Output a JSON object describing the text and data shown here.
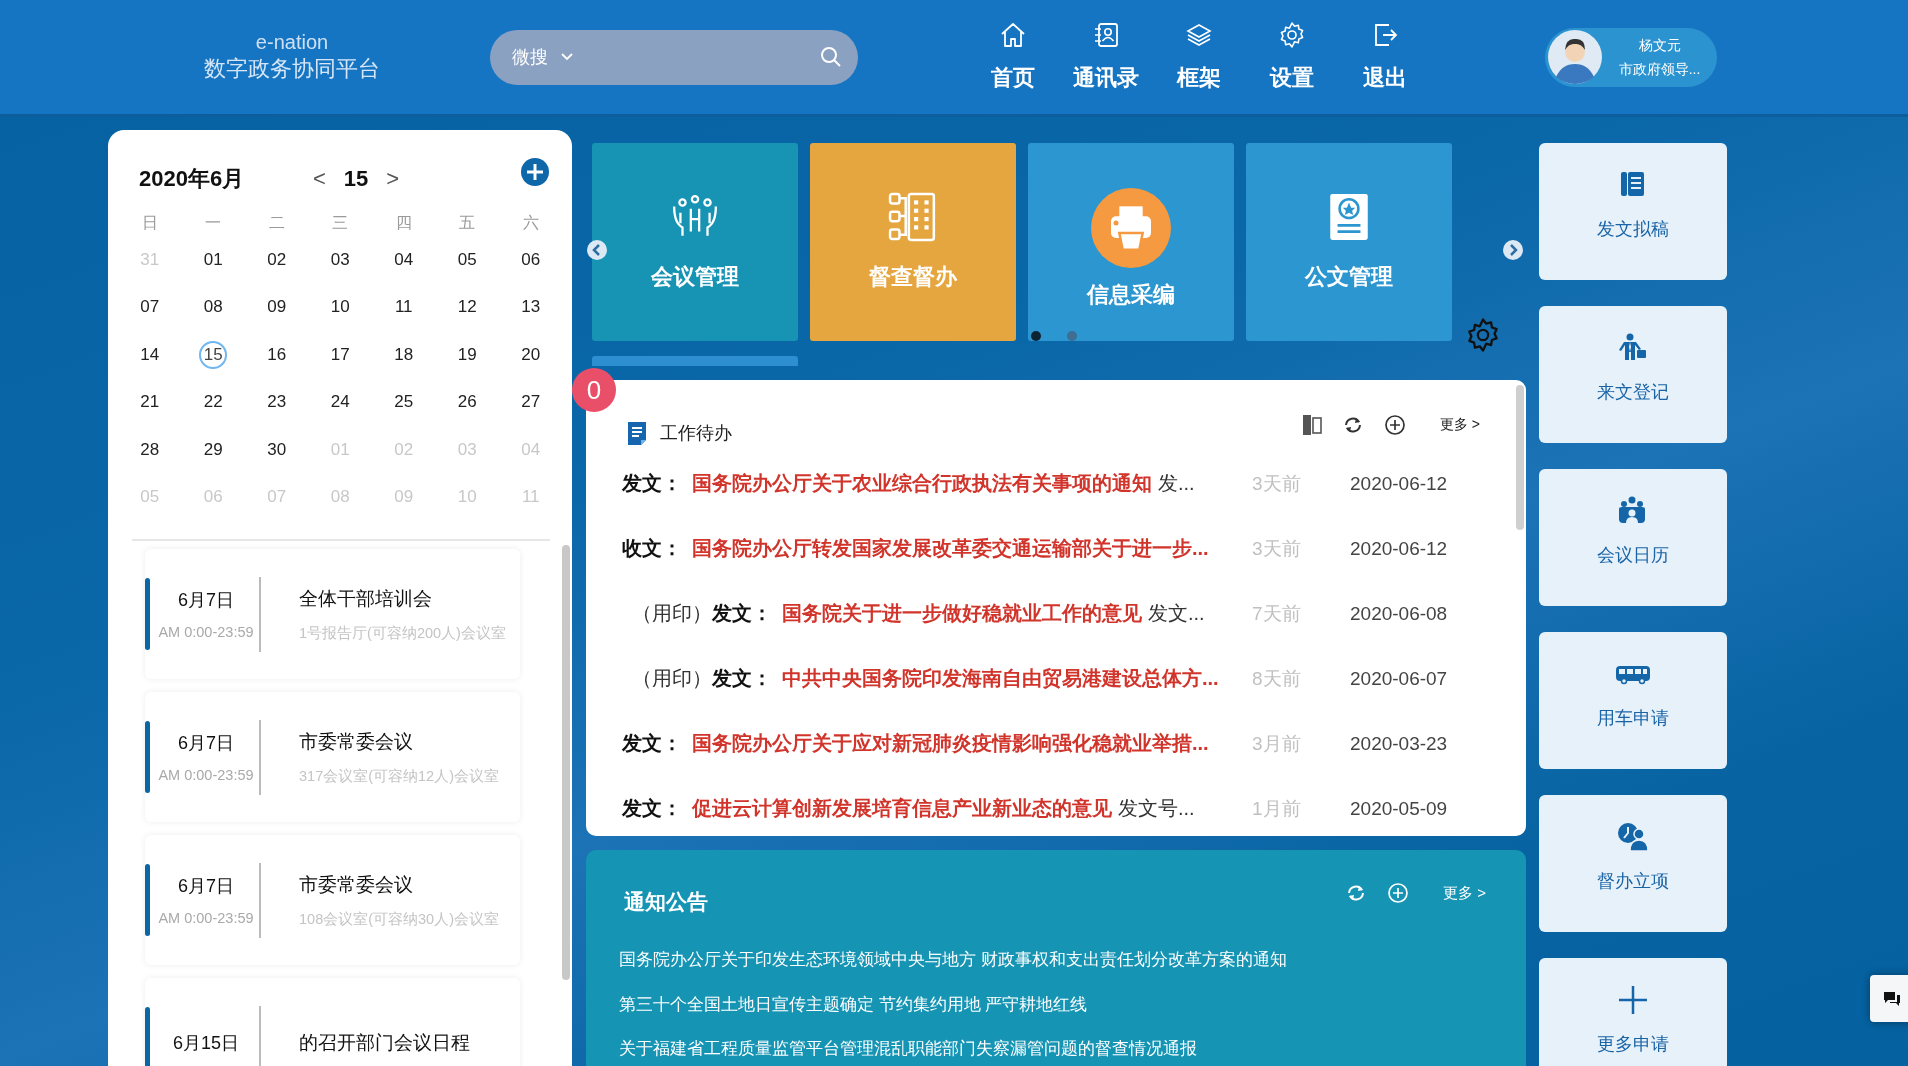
{
  "header": {
    "logo_top": "e-nation",
    "logo_bottom": "数字政务协同平台",
    "search": {
      "scope": "微搜"
    },
    "nav": [
      {
        "label": "首页",
        "kind": "home"
      },
      {
        "label": "通讯录",
        "kind": "contacts"
      },
      {
        "label": "框架",
        "kind": "layers"
      },
      {
        "label": "设置",
        "kind": "settings"
      },
      {
        "label": "退出",
        "kind": "exit"
      }
    ],
    "user": {
      "name": "杨文元",
      "role": "市政府领导..."
    }
  },
  "calendar": {
    "title": "2020年6月",
    "prev": "<",
    "day": "15",
    "next": ">",
    "weekdays": [
      "日",
      "一",
      "二",
      "三",
      "四",
      "五",
      "六"
    ],
    "weeks": [
      [
        {
          "day": "31",
          "muted": true,
          "selected": false
        },
        {
          "day": "01",
          "muted": false,
          "selected": false
        },
        {
          "day": "02",
          "muted": false,
          "selected": false
        },
        {
          "day": "03",
          "muted": false,
          "selected": false
        },
        {
          "day": "04",
          "muted": false,
          "selected": false
        },
        {
          "day": "05",
          "muted": false,
          "selected": false
        },
        {
          "day": "06",
          "muted": false,
          "selected": false
        }
      ],
      [
        {
          "day": "07",
          "muted": false,
          "selected": false
        },
        {
          "day": "08",
          "muted": false,
          "selected": false
        },
        {
          "day": "09",
          "muted": false,
          "selected": false
        },
        {
          "day": "10",
          "muted": false,
          "selected": false
        },
        {
          "day": "11",
          "muted": false,
          "selected": false
        },
        {
          "day": "12",
          "muted": false,
          "selected": false
        },
        {
          "day": "13",
          "muted": false,
          "selected": false
        }
      ],
      [
        {
          "day": "14",
          "muted": false,
          "selected": false
        },
        {
          "day": "15",
          "muted": false,
          "selected": true
        },
        {
          "day": "16",
          "muted": false,
          "selected": false
        },
        {
          "day": "17",
          "muted": false,
          "selected": false
        },
        {
          "day": "18",
          "muted": false,
          "selected": false
        },
        {
          "day": "19",
          "muted": false,
          "selected": false
        },
        {
          "day": "20",
          "muted": false,
          "selected": false
        }
      ],
      [
        {
          "day": "21",
          "muted": false,
          "selected": false
        },
        {
          "day": "22",
          "muted": false,
          "selected": false
        },
        {
          "day": "23",
          "muted": false,
          "selected": false
        },
        {
          "day": "24",
          "muted": false,
          "selected": false
        },
        {
          "day": "25",
          "muted": false,
          "selected": false
        },
        {
          "day": "26",
          "muted": false,
          "selected": false
        },
        {
          "day": "27",
          "muted": false,
          "selected": false
        }
      ],
      [
        {
          "day": "28",
          "muted": false,
          "selected": false
        },
        {
          "day": "29",
          "muted": false,
          "selected": false
        },
        {
          "day": "30",
          "muted": false,
          "selected": false
        },
        {
          "day": "01",
          "muted": true,
          "selected": false
        },
        {
          "day": "02",
          "muted": true,
          "selected": false
        },
        {
          "day": "03",
          "muted": true,
          "selected": false
        },
        {
          "day": "04",
          "muted": true,
          "selected": false
        }
      ],
      [
        {
          "day": "05",
          "muted": true,
          "selected": false
        },
        {
          "day": "06",
          "muted": true,
          "selected": false
        },
        {
          "day": "07",
          "muted": true,
          "selected": false
        },
        {
          "day": "08",
          "muted": true,
          "selected": false
        },
        {
          "day": "09",
          "muted": true,
          "selected": false
        },
        {
          "day": "10",
          "muted": true,
          "selected": false
        },
        {
          "day": "11",
          "muted": true,
          "selected": false
        }
      ]
    ]
  },
  "events": [
    {
      "date": "6月7日",
      "time": "AM 0:00-23:59",
      "title": "全体干部培训会",
      "place": "1号报告厅(可容纳200人)会议室"
    },
    {
      "date": "6月7日",
      "time": "AM 0:00-23:59",
      "title": "市委常委会议",
      "place": "317会议室(可容纳12人)会议室"
    },
    {
      "date": "6月7日",
      "time": "AM 0:00-23:59",
      "title": "市委常委会议",
      "place": "108会议室(可容纳30人)会议室"
    },
    {
      "date": "6月15日",
      "title": "的召开部门会议日程"
    }
  ],
  "tiles": [
    {
      "label": "会议管理",
      "kind": "meeting",
      "color": "#1793b4"
    },
    {
      "label": "督查督办",
      "kind": "flow",
      "color": "#e5a63f"
    },
    {
      "label": "信息采编",
      "kind": "printer",
      "color": "#2b96cf"
    },
    {
      "label": "公文管理",
      "kind": "certificate",
      "color": "#2b96cf"
    }
  ],
  "tile_pages": [
    {
      "selected": true
    },
    {
      "selected": false
    }
  ],
  "todo": {
    "badge": "0",
    "title": "工作待办",
    "more": "更多 >",
    "items": [
      {
        "type": "发文：",
        "title": "国务院办公厅关于农业综合行政执法有关事项的通知",
        "suffix": "发...",
        "age": "3天前",
        "date": "2020-06-12"
      },
      {
        "type": "收文：",
        "title": "国务院办公厅转发国家发展改革委交通运输部关于进一步...",
        "age": "3天前",
        "date": "2020-06-12"
      },
      {
        "prefix": "（用印）",
        "type": "发文：",
        "title": "国务院关于进一步做好稳就业工作的意见",
        "suffix": "发文...",
        "age": "7天前",
        "date": "2020-06-08"
      },
      {
        "prefix": "（用印）",
        "type": "发文：",
        "title": "中共中央国务院印发海南自由贸易港建设总体方...",
        "age": "8天前",
        "date": "2020-06-07"
      },
      {
        "type": "发文：",
        "title": "国务院办公厅关于应对新冠肺炎疫情影响强化稳就业举措...",
        "age": "3月前",
        "date": "2020-03-23"
      },
      {
        "type": "发文：",
        "title": "促进云计算创新发展培育信息产业新业态的意见",
        "suffix": "发文号...",
        "age": "1月前",
        "date": "2020-05-09"
      }
    ]
  },
  "notice": {
    "title": "通知公告",
    "more": "更多 >",
    "items": [
      "国务院办公厅关于印发生态环境领域中央与地方 财政事权和支出责任划分改革方案的通知",
      "第三十个全国土地日宣传主题确定 节约集约用地 严守耕地红线",
      "关于福建省工程质量监管平台管理混乱职能部门失察漏管问题的督查情况通报"
    ]
  },
  "quick": [
    {
      "label": "发文拟稿",
      "kind": "book"
    },
    {
      "label": "来文登记",
      "kind": "businessman"
    },
    {
      "label": "会议日历",
      "kind": "group"
    },
    {
      "label": "用车申请",
      "kind": "bus"
    },
    {
      "label": "督办立项",
      "kind": "clock-person"
    },
    {
      "label": "更多申请",
      "kind": "plus"
    }
  ]
}
